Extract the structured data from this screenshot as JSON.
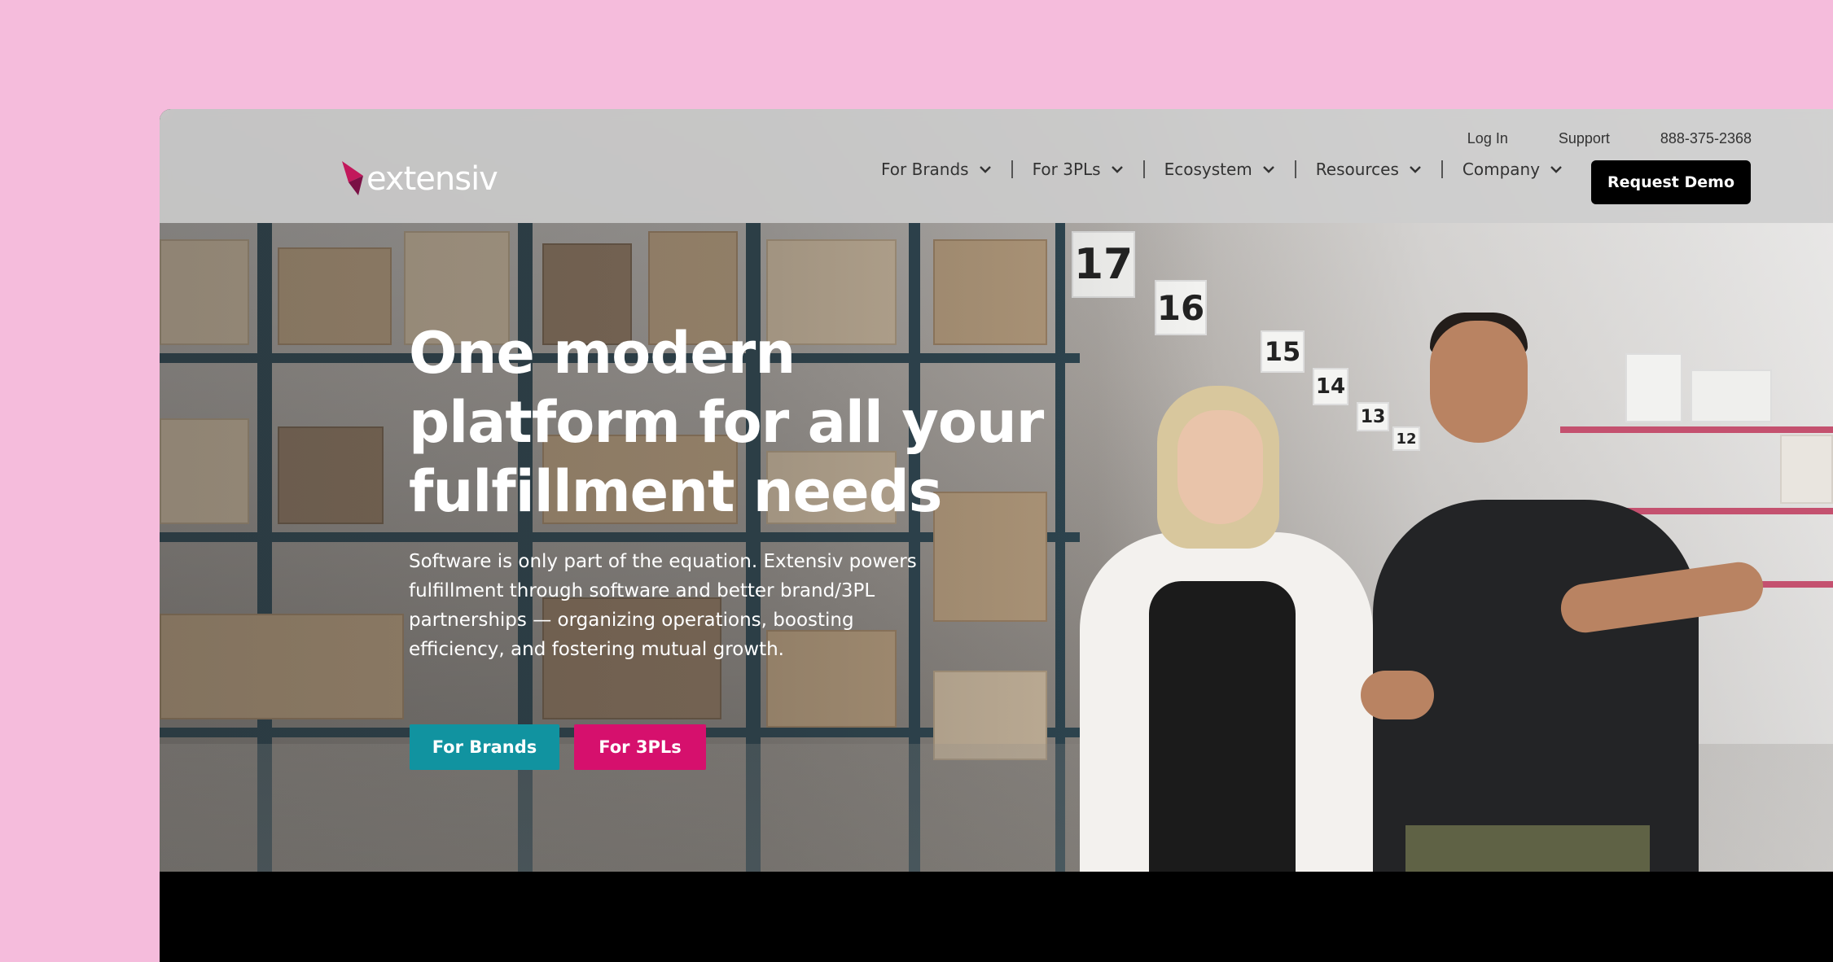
{
  "brand": {
    "name": "extensiv",
    "mark_color": "#c2185b"
  },
  "utility_links": [
    "Log In",
    "Support",
    "888-375-2368"
  ],
  "nav": {
    "items": [
      {
        "label": "For Brands",
        "icon": "chevron-down-icon"
      },
      {
        "label": "For 3PLs",
        "icon": "chevron-down-icon"
      },
      {
        "label": "Ecosystem",
        "icon": "chevron-down-icon"
      },
      {
        "label": "Resources",
        "icon": "chevron-down-icon"
      },
      {
        "label": "Company",
        "icon": "chevron-down-icon"
      }
    ],
    "cta_label": "Request Demo"
  },
  "hero": {
    "headline": "One modern platform for all your fulfillment needs",
    "subcopy": "Software is only part of the equation. Extensiv powers fulfillment through software and better brand/3PL partnerships — organizing operations, boosting efficiency, and fostering mutual growth.",
    "buttons": [
      {
        "label": "For Brands",
        "color": "#1193a0"
      },
      {
        "label": "For 3PLs",
        "color": "#d6106d"
      }
    ],
    "aisle_signs": [
      "17",
      "16",
      "15",
      "14",
      "13",
      "12"
    ]
  },
  "colors": {
    "page_background": "#f5bcdc",
    "header_background": "#cdcdcd",
    "cta_dark": "#000000"
  }
}
